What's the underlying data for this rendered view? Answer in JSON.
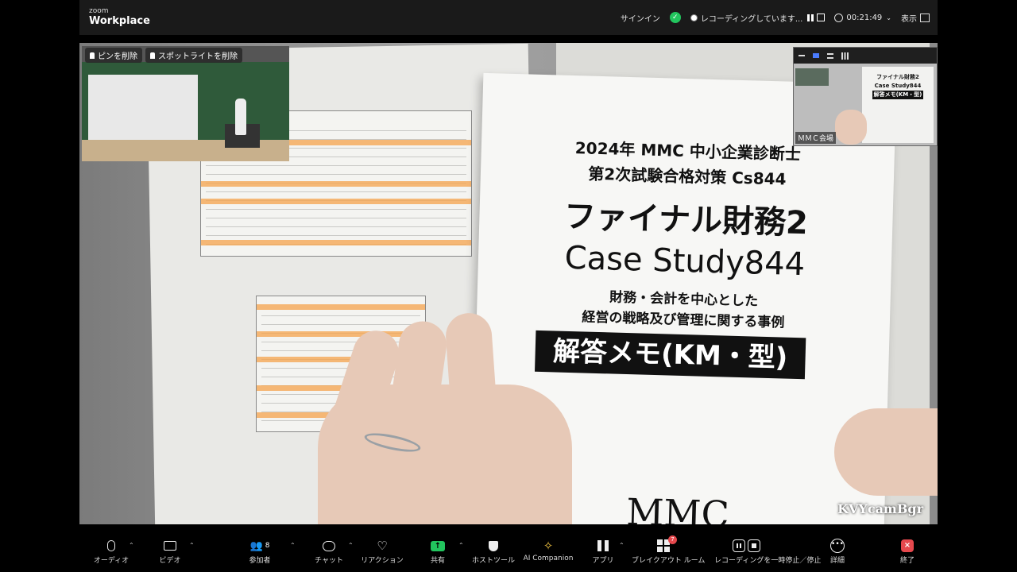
{
  "app": {
    "logo_small": "zoom",
    "logo_big": "Workplace"
  },
  "topbar": {
    "sign_in": "サインイン",
    "recording_status": "レコーディングしています...",
    "elapsed_time": "00:21:49",
    "view_label": "表示"
  },
  "pinned_video": {
    "unpin_label": "ピンを削除",
    "remove_spotlight_label": "スポットライトを削除"
  },
  "self_view": {
    "name": "ＭＭＣ会場",
    "doc_lines": [
      "ファイナル財務2",
      "Case Study844",
      "解答メモ(KM・型)"
    ]
  },
  "shared_document": {
    "line1": "2024年 MMC 中小企業診断士",
    "line2": "第2次試験合格対策 Cs844",
    "line3": "ファイナル財務2",
    "line4": "Case Study844",
    "line5": "財務・会計を中心とした",
    "line6": "経営の戦略及び管理に関する事例",
    "line7": "解答メモ(KM・型)",
    "line8": "MMC",
    "watermark": "KVYcamBgr"
  },
  "toolbar": {
    "audio": "オーディオ",
    "video": "ビデオ",
    "participants": "参加者",
    "participants_count": "8",
    "chat": "チャット",
    "reactions": "リアクション",
    "share": "共有",
    "host_tools": "ホストツール",
    "ai_companion": "AI Companion",
    "apps": "アプリ",
    "breakout_rooms": "ブレイクアウト ルーム",
    "breakout_badge": "7",
    "recording_control": "レコーディングを一時停止／停止",
    "more": "詳細",
    "end": "終了"
  },
  "colors": {
    "accent_green": "#22c55e",
    "end_red": "#e5484d",
    "highlight_orange": "#f5a34b"
  }
}
